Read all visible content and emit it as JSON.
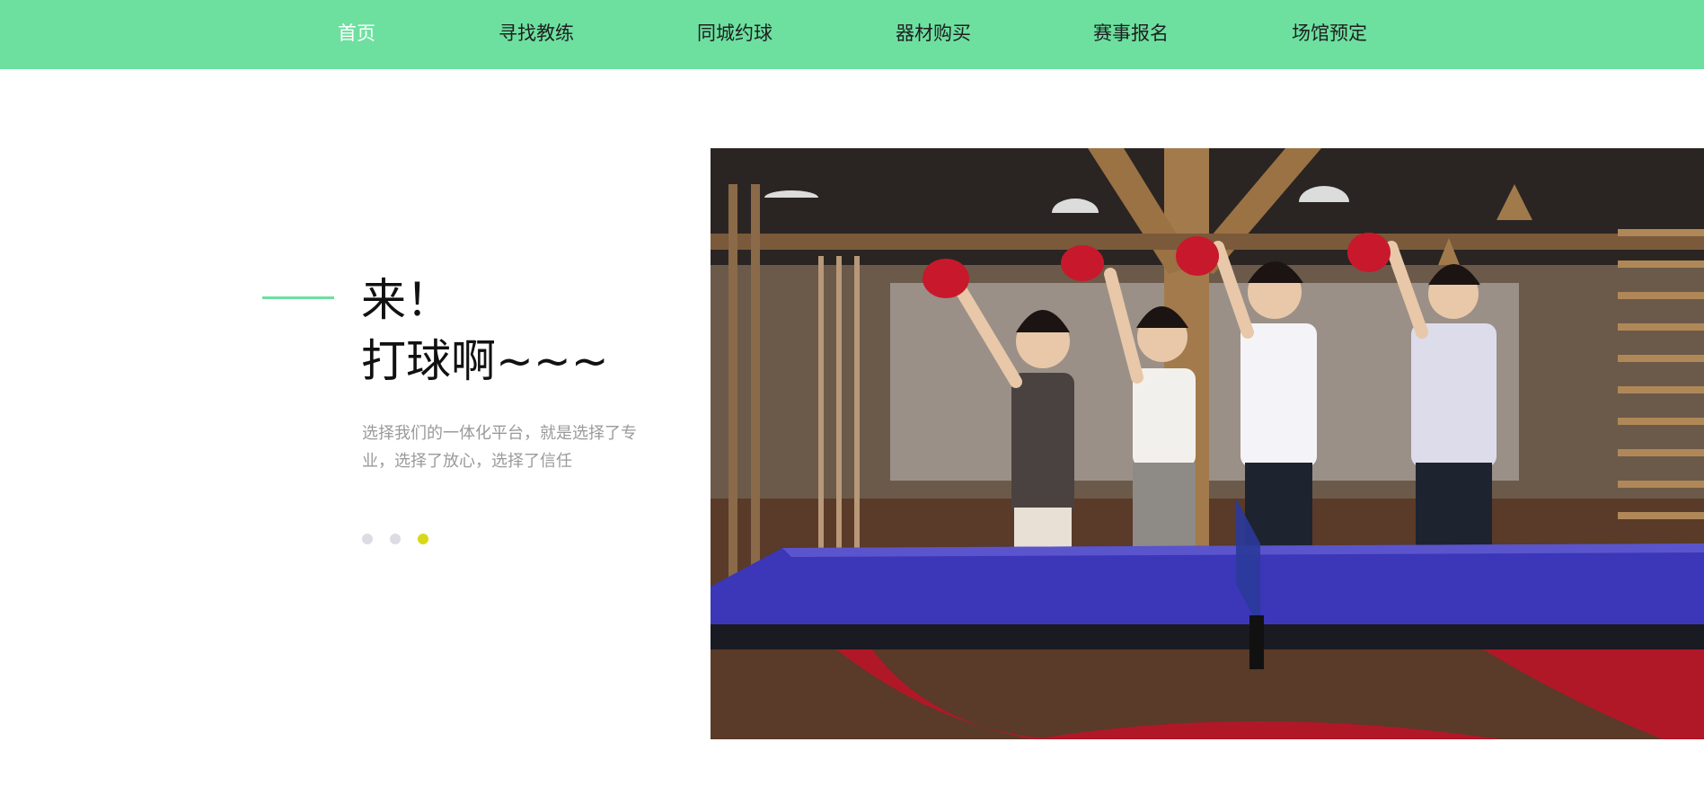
{
  "nav": {
    "items": [
      {
        "label": "首页",
        "active": true
      },
      {
        "label": "寻找教练",
        "active": false
      },
      {
        "label": "同城约球",
        "active": false
      },
      {
        "label": "器材购买",
        "active": false
      },
      {
        "label": "赛事报名",
        "active": false
      },
      {
        "label": "场馆预定",
        "active": false
      }
    ]
  },
  "hero": {
    "title_line1": "来！",
    "title_line2": "打球啊~~~",
    "subtitle": "选择我们的一体化平台，就是选择了专业，选择了放心，选择了信任"
  },
  "carousel": {
    "slide_count": 3,
    "active_index": 2
  },
  "colors": {
    "nav_bg": "#6de0a0",
    "accent_line": "#6de0a0",
    "dot_inactive": "#dcdce4",
    "dot_active": "#d8d818",
    "table_blue": "#3c36b8",
    "paddle_red": "#c8182c"
  }
}
